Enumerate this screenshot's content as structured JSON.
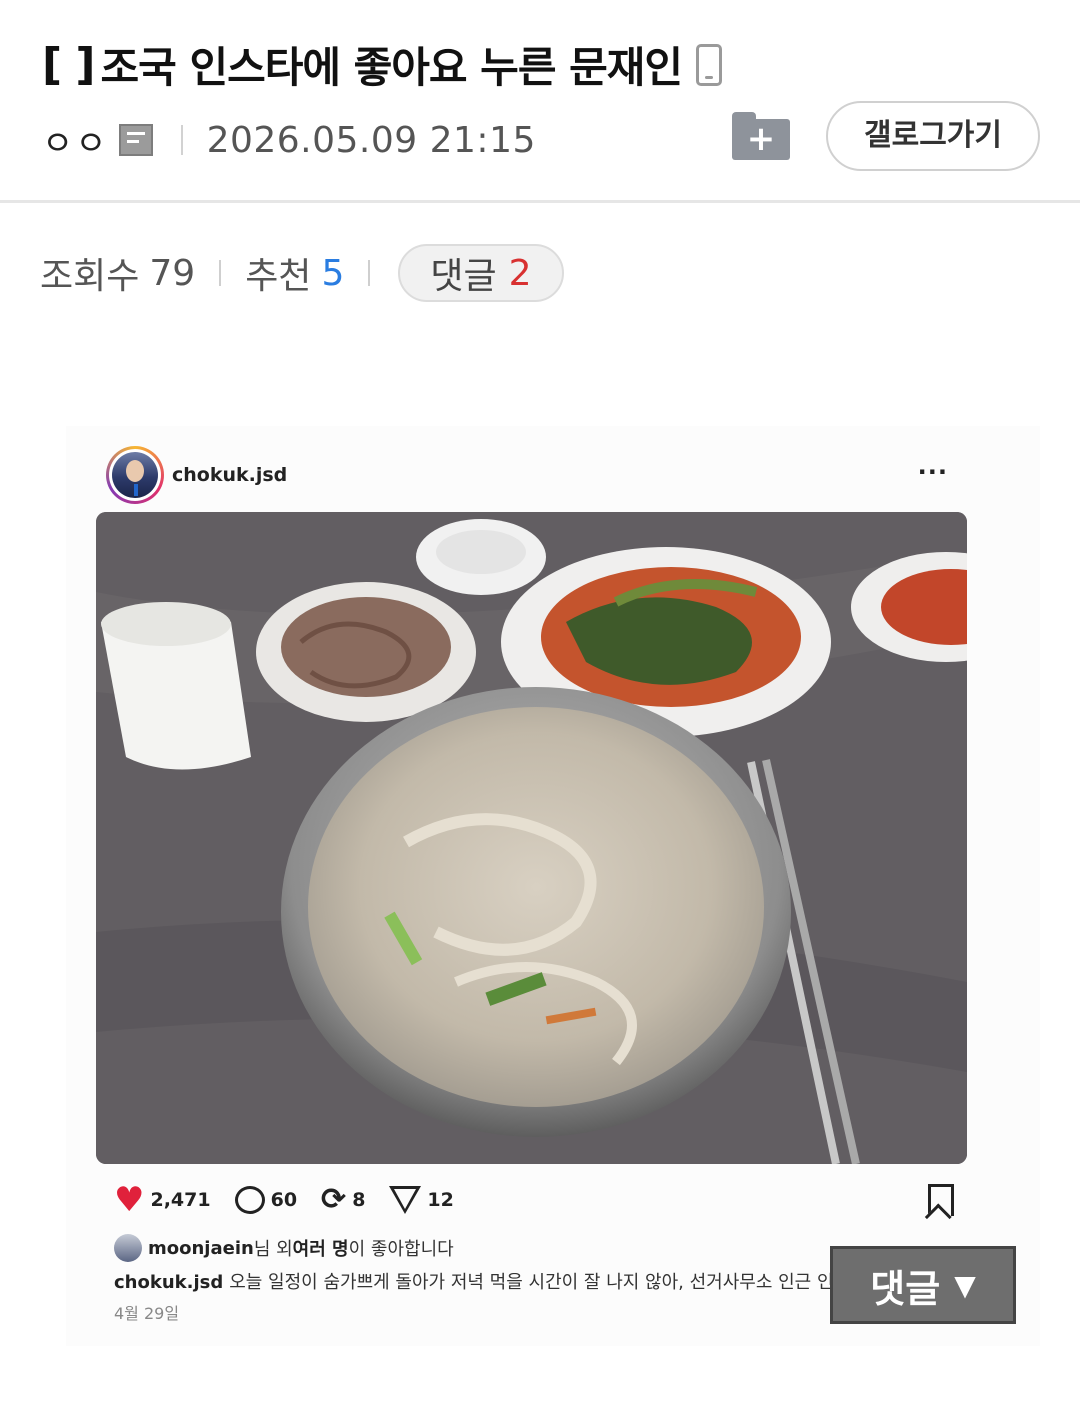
{
  "post": {
    "title_prefix": "[  ]",
    "title": "조국 인스타에 좋아요 누른 문재인",
    "device_icon": "mobile-icon",
    "author": "ㅇㅇ",
    "author_icon": "member-icon",
    "date": "2026.05.09 21:15"
  },
  "header_actions": {
    "folder_icon": "folder-plus-icon",
    "gallery_button": "갤로그가기"
  },
  "stats": {
    "views_label": "조회수",
    "views": "79",
    "recommend_label": "추천",
    "recommend": "5",
    "comments_label": "댓글",
    "comments": "2"
  },
  "embedded_post": {
    "username": "chokuk.jsd",
    "more": "···",
    "likes": "2,471",
    "comments": "60",
    "reposts": "8",
    "shares": "12",
    "liked_by_user": "moonjaein",
    "liked_by_mid": "님 외 ",
    "liked_by_bold": "여러 명",
    "liked_by_suffix": "이 좋아합니다",
    "caption_user": "chokuk.jsd",
    "caption_text": "오늘 일정이 숨가쁘게 돌아가 저녁 먹을 시간이 잘 나지 않아, 선거사무소 인근 인",
    "post_date": "4월 29일"
  },
  "floating": {
    "comment_label": "댓글",
    "arrow": "▼"
  },
  "colors": {
    "accent_blue": "#2a7de1",
    "accent_red": "#d83131",
    "heart": "#e0213b"
  }
}
